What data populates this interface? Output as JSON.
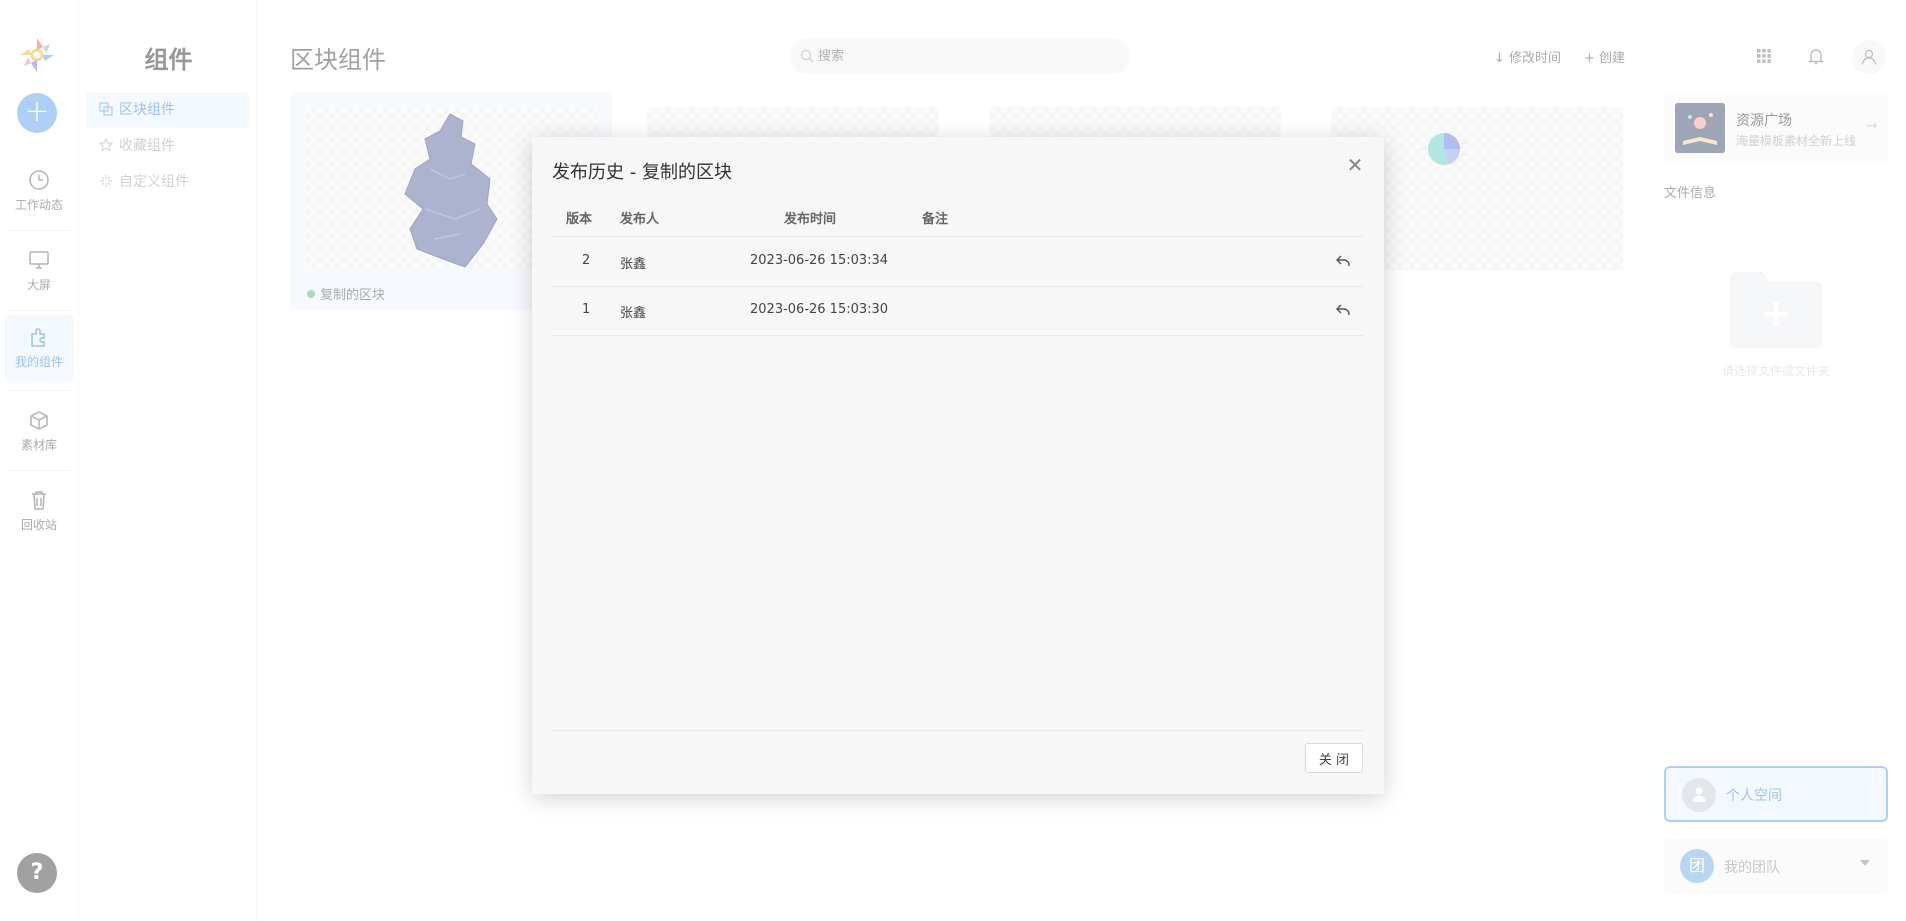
{
  "nav": {
    "items": [
      {
        "label": "工作动态",
        "icon": "clock-icon"
      },
      {
        "label": "大屏",
        "icon": "monitor-icon"
      },
      {
        "label": "我的组件",
        "icon": "puzzle-icon",
        "active": true
      },
      {
        "label": "素材库",
        "icon": "box-icon"
      },
      {
        "label": "回收站",
        "icon": "trash-icon"
      }
    ],
    "help_label": "?"
  },
  "sidebar": {
    "title": "组件",
    "items": [
      {
        "label": "区块组件",
        "icon": "copy-icon",
        "active": true
      },
      {
        "label": "收藏组件",
        "icon": "star-icon"
      },
      {
        "label": "自定义组件",
        "icon": "sparkle-icon"
      }
    ]
  },
  "header": {
    "title": "区块组件",
    "search_placeholder": "搜索",
    "sort_label": "修改时间",
    "create_label": "创建"
  },
  "cards": [
    {
      "name": "复制的区块",
      "status_color": "#6cc36c"
    }
  ],
  "right_panel": {
    "resource": {
      "title": "资源广场",
      "subtitle": "海量模板素材全新上线"
    },
    "file_info_label": "文件信息",
    "folder_hint": "请选择文件或文件夹",
    "personal_space": "个人空间",
    "team": {
      "avatar_text": "团",
      "label": "我的团队"
    }
  },
  "modal": {
    "title": "发布历史 - 复制的区块",
    "columns": {
      "version": "版本",
      "publisher": "发布人",
      "time": "发布时间",
      "note": "备注"
    },
    "rows": [
      {
        "version": "2",
        "publisher": "张鑫",
        "time": "2023-06-26 15:03:34",
        "note": ""
      },
      {
        "version": "1",
        "publisher": "张鑫",
        "time": "2023-06-26 15:03:30",
        "note": ""
      }
    ],
    "close_button": "关 闭"
  },
  "colors": {
    "accent": "#4a90e2",
    "accent_bg": "#eaf4fd"
  }
}
